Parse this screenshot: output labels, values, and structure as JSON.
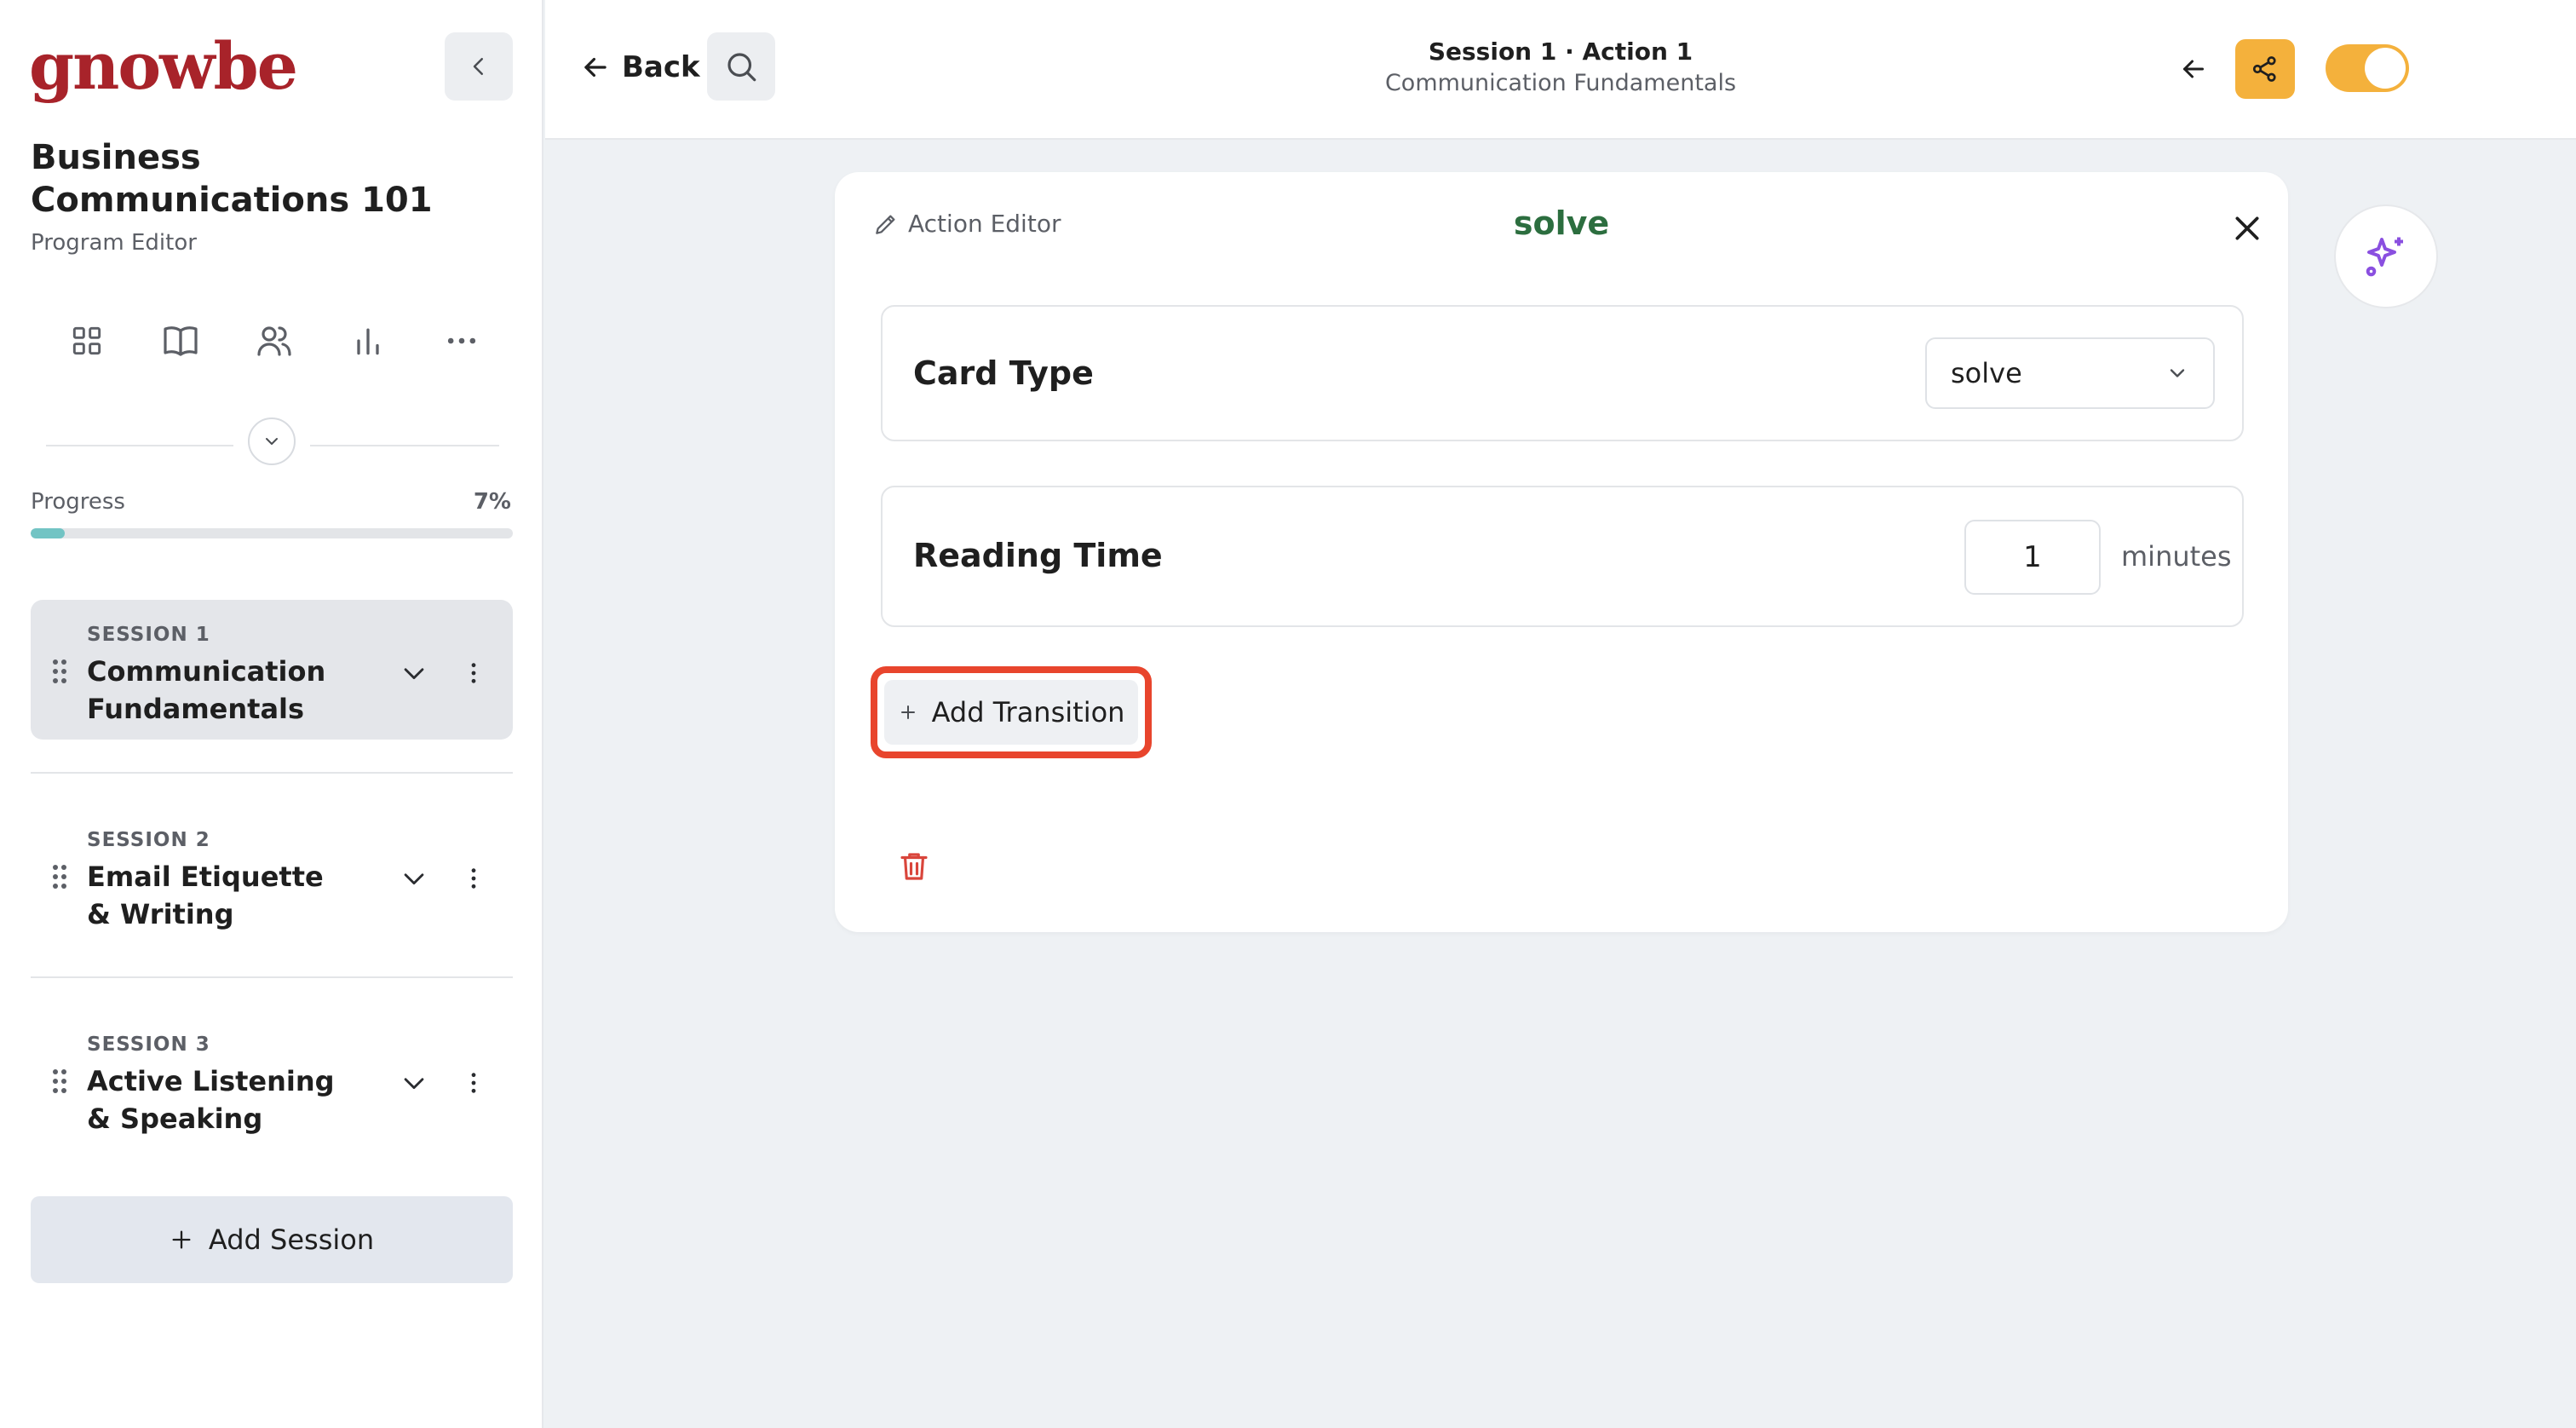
{
  "sidebar": {
    "logo": "gnowbe",
    "program_title": "Business Communications 101",
    "program_subtitle": "Program Editor",
    "tools": [
      {
        "icon": "grid-icon"
      },
      {
        "icon": "book-icon"
      },
      {
        "icon": "users-icon"
      },
      {
        "icon": "bar-chart-icon"
      },
      {
        "icon": "more-horizontal-icon"
      }
    ],
    "progress_label": "Progress",
    "progress_text": "7%",
    "progress_value": 0.07,
    "sessions": [
      {
        "number": "SESSION 1",
        "name": "Communication Fundamentals",
        "active": true
      },
      {
        "number": "SESSION 2",
        "name": "Email Etiquette & Writing",
        "active": false
      },
      {
        "number": "SESSION 3",
        "name": "Active Listening & Speaking",
        "active": false
      }
    ],
    "add_session_label": "Add Session"
  },
  "topbar": {
    "back_label": "Back",
    "breadcrumb_title": "Session 1 · Action 1",
    "breadcrumb_subtitle": "Communication Fundamentals",
    "toggle_on": true
  },
  "editor": {
    "label": "Action Editor",
    "title": "solve",
    "card_type_label": "Card Type",
    "card_type_value": "solve",
    "reading_time_label": "Reading Time",
    "reading_time_value": "1",
    "reading_time_unit": "minutes",
    "add_transition_label": "Add Transition"
  },
  "colors": {
    "brand": "#a8232a",
    "accent": "#f4b13c",
    "title_green": "#2c6e3f",
    "highlight": "#e8452d",
    "progress": "#72c4c4",
    "danger": "#d9453b",
    "ai": "#8a4fe0"
  }
}
